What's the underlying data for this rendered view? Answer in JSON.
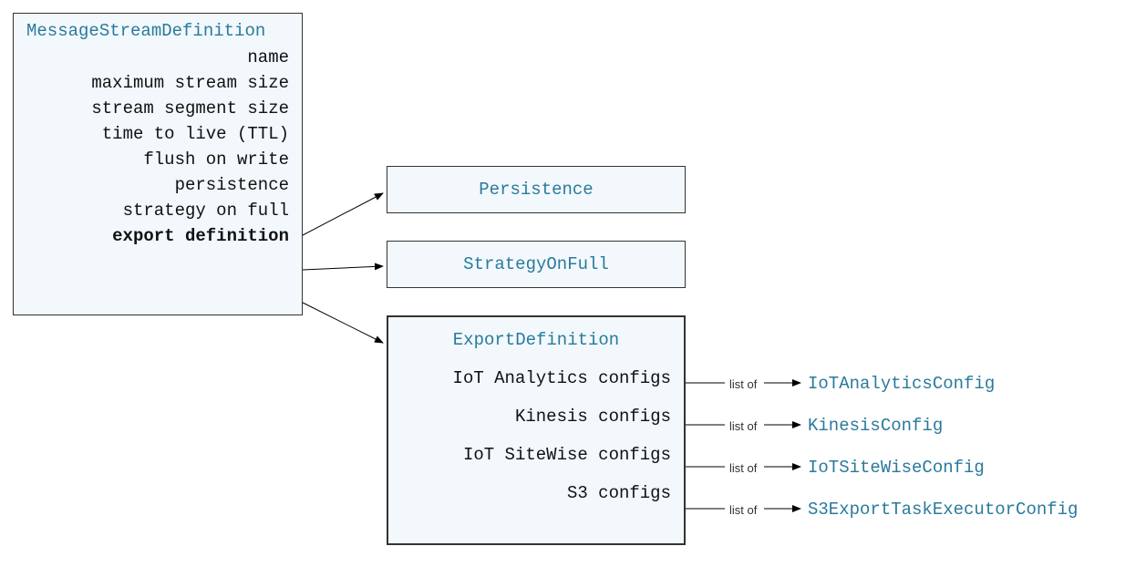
{
  "msd": {
    "title": "MessageStreamDefinition",
    "props": {
      "name": "name",
      "maxsize": "maximum stream size",
      "segsize": "stream segment size",
      "ttl": "time to live (TTL)",
      "flush": "flush on write",
      "persistence": "persistence",
      "strategy": "strategy on full",
      "exportdef": "export definition"
    }
  },
  "persistence_box": "Persistence",
  "strategy_box": "StrategyOnFull",
  "exportdef": {
    "title": "ExportDefinition",
    "props": {
      "iotanalytics": "IoT Analytics configs",
      "kinesis": "Kinesis configs",
      "sitewise": "IoT SiteWise configs",
      "s3": "S3 configs"
    }
  },
  "listof_label": "list of",
  "types": {
    "iotanalytics": "IoTAnalyticsConfig",
    "kinesis": "KinesisConfig",
    "sitewise": "IoTSiteWiseConfig",
    "s3": "S3ExportTaskExecutorConfig"
  }
}
